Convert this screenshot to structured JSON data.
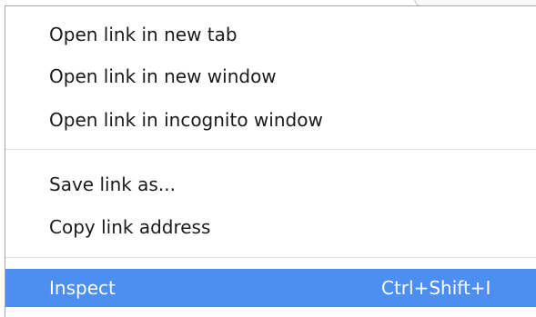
{
  "menu": {
    "items": [
      {
        "label": "Open link in new tab"
      },
      {
        "label": "Open link in new window"
      },
      {
        "label": "Open link in incognito window"
      },
      {
        "label": "Save link as..."
      },
      {
        "label": "Copy link address"
      },
      {
        "label": "Inspect",
        "shortcut": "Ctrl+Shift+I",
        "highlighted": true
      }
    ]
  },
  "colors": {
    "highlight": "#4d8ff0",
    "highlight_text": "#ffffff",
    "menu_text": "#1a1a1a",
    "separator": "#e2e2e2",
    "border": "#a9a9a9"
  }
}
